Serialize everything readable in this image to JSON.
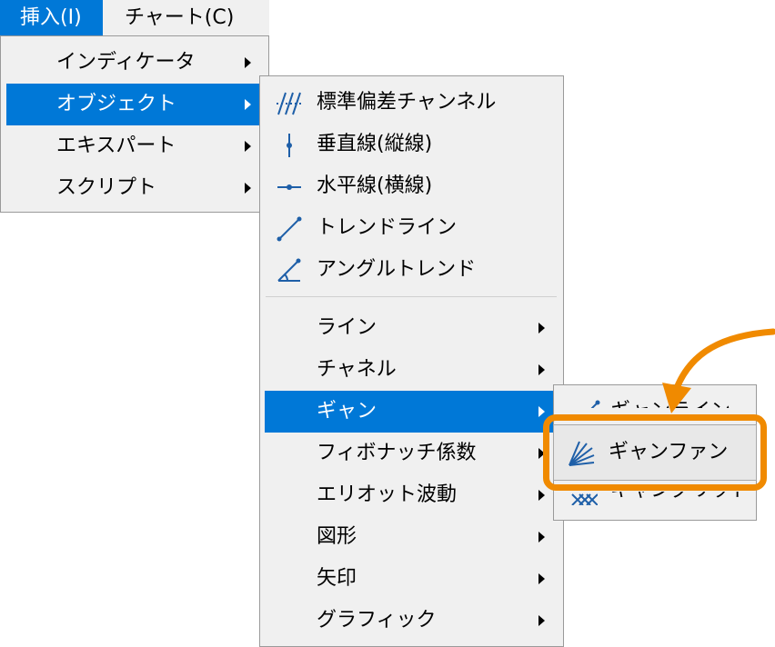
{
  "menubar": {
    "insert": "挿入(I)",
    "chart": "チャート(C)"
  },
  "insert_menu": {
    "items": [
      {
        "label": "インディケータ",
        "submenu": true
      },
      {
        "label": "オブジェクト",
        "submenu": true,
        "highlighted": true
      },
      {
        "label": "エキスパート",
        "submenu": true
      },
      {
        "label": "スクリプト",
        "submenu": true
      }
    ]
  },
  "objects_menu": {
    "tools": [
      {
        "label": "標準偏差チャンネル",
        "icon": "std-deviation-channel-icon"
      },
      {
        "label": "垂直線(縦線)",
        "icon": "vertical-line-icon"
      },
      {
        "label": "水平線(横線)",
        "icon": "horizontal-line-icon"
      },
      {
        "label": "トレンドライン",
        "icon": "trendline-icon"
      },
      {
        "label": "アングルトレンド",
        "icon": "angle-trend-icon"
      }
    ],
    "groups": [
      {
        "label": "ライン",
        "submenu": true
      },
      {
        "label": "チャネル",
        "submenu": true
      },
      {
        "label": "ギャン",
        "submenu": true,
        "highlighted": true
      },
      {
        "label": "フィボナッチ係数",
        "submenu": true
      },
      {
        "label": "エリオット波動",
        "submenu": true
      },
      {
        "label": "図形",
        "submenu": true
      },
      {
        "label": "矢印",
        "submenu": true
      },
      {
        "label": "グラフィック",
        "submenu": true
      }
    ]
  },
  "gann_menu": {
    "items": [
      {
        "label": "ギャンライン",
        "icon": "gann-line-icon",
        "partially_hidden": true
      },
      {
        "label": "ギャンファン",
        "icon": "gann-fan-icon",
        "emphasized": true
      },
      {
        "label": "ギャングリッド",
        "icon": "gann-grid-icon",
        "partially_hidden": true
      }
    ]
  },
  "colors": {
    "highlight": "#0078d7",
    "menu_bg": "#f0f0f0",
    "callout": "#f08a00",
    "icon_blue": "#1e5fa8"
  }
}
